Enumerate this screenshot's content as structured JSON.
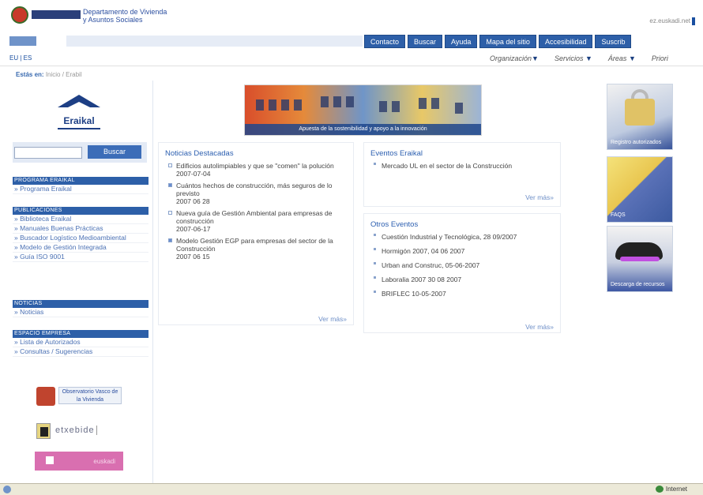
{
  "header": {
    "dept_line1": "Departamento de Vivienda",
    "dept_line2": "y Asuntos Sociales",
    "lang_top": "ez.euskadi.net"
  },
  "topnav": [
    "Contacto",
    "Buscar",
    "Ayuda",
    "Mapa del sitio",
    "Accesibilidad",
    "Suscrib"
  ],
  "subnav": {
    "lang": "EU | ES",
    "menu": [
      {
        "label": "Organización",
        "arrow": "▼"
      },
      {
        "label": "Servicios",
        "arrow": "▼"
      },
      {
        "label": "Áreas",
        "arrow": "▼"
      },
      {
        "label": "Priori",
        "arrow": ""
      }
    ]
  },
  "breadcrumb": {
    "lead": "Estás en:",
    "path": "Inicio / Erabil"
  },
  "left": {
    "logo_text": "Eraikal",
    "search_button": "Buscar",
    "sections": [
      {
        "head": "PROGRAMA ERAIKAL",
        "items": [
          "» Programa Eraikal"
        ]
      },
      {
        "head": "PUBLICACIONES",
        "items": [
          "» Biblioteca Eraikal",
          "» Manuales Buenas Prácticas",
          "» Buscador Logístico Medioambiental",
          "» Modelo de Gestión Integrada",
          "» Guía ISO 9001"
        ]
      },
      {
        "head": "NOTICIAS",
        "items": [
          "» Noticias"
        ]
      },
      {
        "head": "ESPACIO EMPRESA",
        "items": [
          "» Lista de Autorizados",
          "» Consultas / Sugerencias"
        ]
      }
    ],
    "banner1_text": "Observatorio Vasco de la Vivienda",
    "banner2_text": "etxebide",
    "banner3_text": "euskadi"
  },
  "hero_caption": "Apuesta de la sostenibilidad y apoyo a la innovación",
  "news": {
    "title": "Noticias Destacadas",
    "items": [
      {
        "text": "Edificios autolimpiables y que se \"comen\" la polución",
        "date": "2007-07-04",
        "filled": false
      },
      {
        "text": "Cuántos hechos de construcción, más seguros de lo previsto",
        "date": "2007 06 28",
        "filled": true
      },
      {
        "text": "Nueva guía de Gestión Ambiental para empresas de construcción",
        "date": "2007-06-17",
        "filled": false
      },
      {
        "text": "Modelo Gestión EGP para empresas del sector de la Construcción",
        "date": "2007 06 15",
        "filled": true
      }
    ],
    "more": "Ver más»"
  },
  "events": {
    "title": "Eventos Eraikal",
    "items": [
      "Mercado UL en el sector de la Construcción"
    ],
    "more": "Ver más»"
  },
  "other_events": {
    "title": "Otros Eventos",
    "items": [
      "Cuestión Industrial y Tecnológica, 28 09/2007",
      "Hormigón 2007, 04 06 2007",
      "Urban and Construc, 05-06-2007",
      "Laboralia 2007 30 08 2007",
      "BRIFLEC 10-05-2007"
    ],
    "more": "Ver más»"
  },
  "right_icons": [
    {
      "label": "Registro autorizados"
    },
    {
      "label": "FAQS"
    },
    {
      "label": "Descarga de recursos"
    }
  ],
  "statusbar": {
    "zone": "Internet"
  }
}
